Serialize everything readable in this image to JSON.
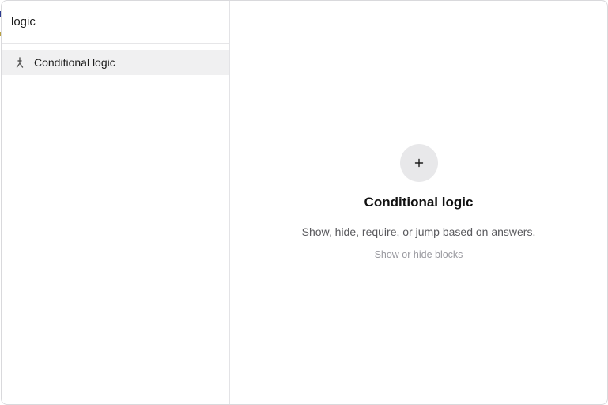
{
  "search": {
    "value": "logic"
  },
  "results": [
    {
      "label": "Conditional logic",
      "icon": "branch-icon"
    }
  ],
  "detail": {
    "icon": "plus-icon",
    "title": "Conditional logic",
    "description": "Show, hide, require, or jump based on answers.",
    "subtext": "Show or hide blocks"
  },
  "colors": {
    "selected_row": "#f0f0f1",
    "plus_button_bg": "#e8e8ea",
    "border": "#e3e3e6"
  }
}
